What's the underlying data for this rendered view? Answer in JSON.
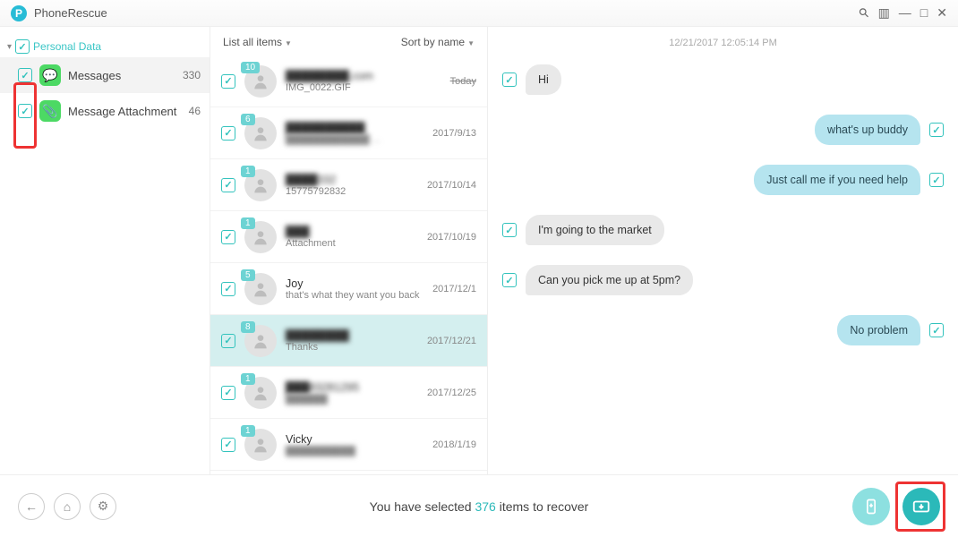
{
  "app": {
    "title": "PhoneRescue"
  },
  "window_controls": {
    "search": "⚲",
    "layout": "▥",
    "min": "—",
    "max": "□",
    "close": "✕"
  },
  "sidebar": {
    "header": "Personal Data",
    "items": [
      {
        "label": "Messages",
        "count": "330"
      },
      {
        "label": "Message Attachment",
        "count": "46"
      }
    ]
  },
  "mid": {
    "list_label": "List all items",
    "sort_label": "Sort by name",
    "conversations": [
      {
        "badge": "10",
        "name": "████████.com",
        "preview": "IMG_0022.GIF",
        "date": "Today",
        "strike": true,
        "blur_name": true
      },
      {
        "badge": "6",
        "name": "██████████",
        "preview": "████████████ ...",
        "date": "2017/9/13",
        "blur_name": true,
        "blur_preview": true
      },
      {
        "badge": "1",
        "name": "████332",
        "preview": "15775792832",
        "date": "2017/10/14",
        "blur_name": true
      },
      {
        "badge": "1",
        "name": "███",
        "preview": "Attachment",
        "date": "2017/10/19",
        "blur_name": true
      },
      {
        "badge": "5",
        "name": "Joy",
        "preview": "that's what they want you back",
        "date": "2017/12/1"
      },
      {
        "badge": "8",
        "name": "████████",
        "preview": "Thanks",
        "date": "2017/12/21",
        "selected": true,
        "blur_name": true
      },
      {
        "badge": "1",
        "name": "███83281295",
        "preview": "██████",
        "date": "2017/12/25",
        "blur_name": true,
        "blur_preview": true
      },
      {
        "badge": "1",
        "name": "Vicky",
        "preview": "██████████",
        "date": "2018/1/19",
        "blur_preview": true
      }
    ]
  },
  "chat": {
    "timestamp": "12/21/2017 12:05:14 PM",
    "messages": [
      {
        "side": "left",
        "text": "Hi"
      },
      {
        "side": "right",
        "text": "what's up buddy"
      },
      {
        "side": "right",
        "text": "Just call me if you need help"
      },
      {
        "side": "left",
        "text": "I'm going to the market"
      },
      {
        "side": "left",
        "text": "Can you pick me up at 5pm?"
      },
      {
        "side": "right",
        "text": "No problem"
      }
    ]
  },
  "footer": {
    "text_before": "You have selected ",
    "count": "376",
    "text_after": " items to recover"
  }
}
